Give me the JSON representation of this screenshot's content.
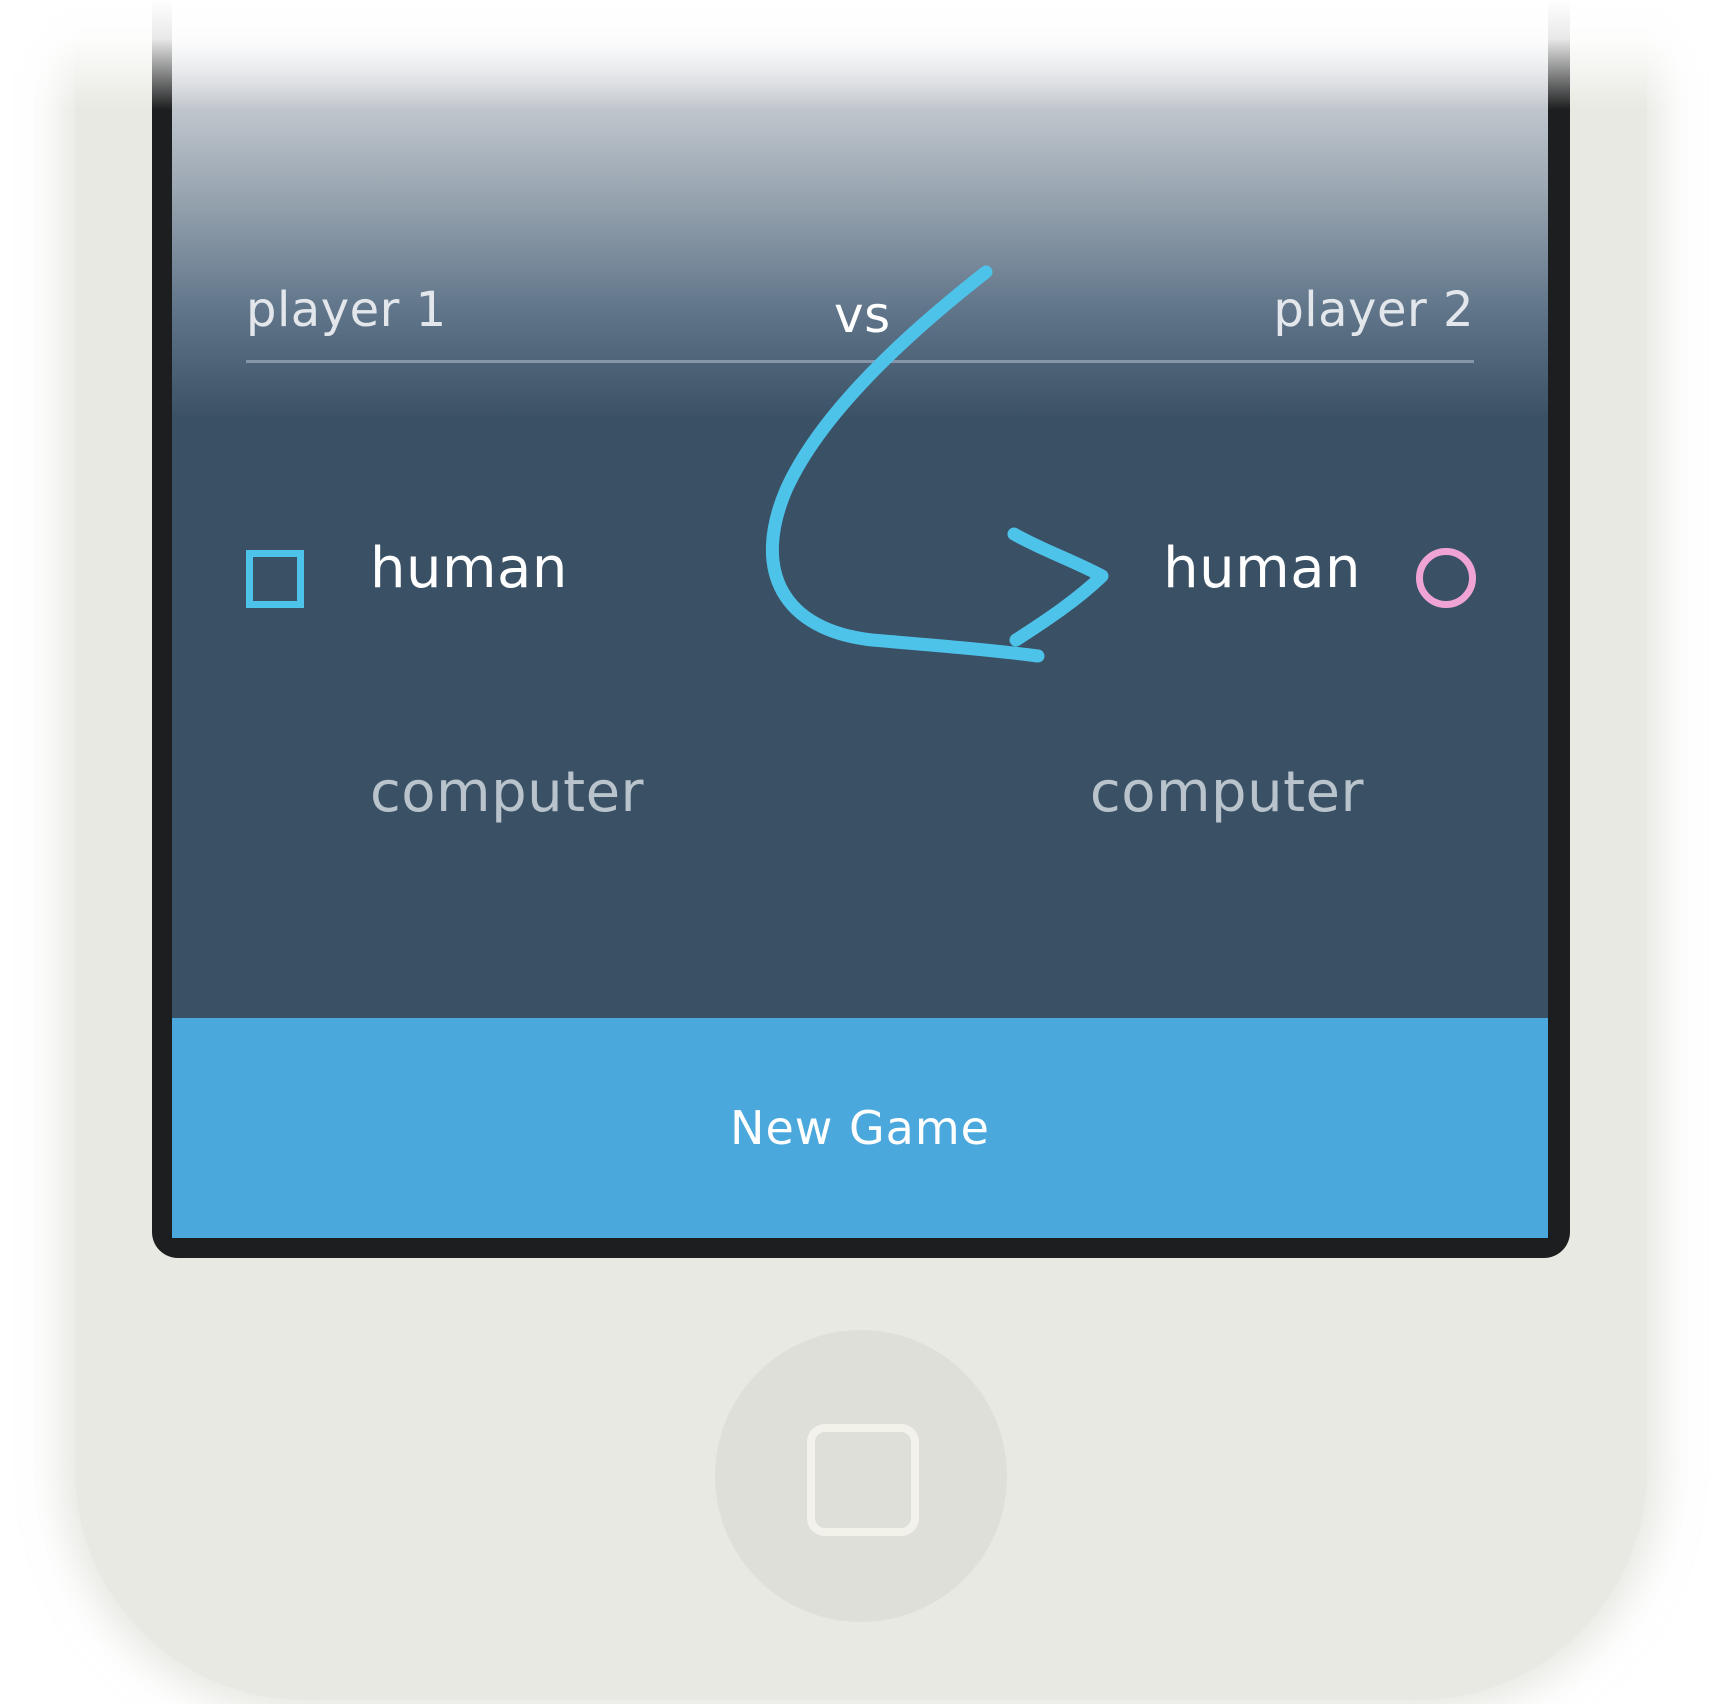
{
  "header": {
    "player1_label": "player 1",
    "vs_label": "vs",
    "player2_label": "player 2"
  },
  "player1": {
    "options": [
      {
        "label": "human",
        "selected": true
      },
      {
        "label": "computer",
        "selected": false
      }
    ],
    "marker_icon": "square-icon",
    "marker_color": "#4ec3ea"
  },
  "player2": {
    "options": [
      {
        "label": "human",
        "selected": true
      },
      {
        "label": "computer",
        "selected": false
      }
    ],
    "marker_icon": "circle-icon",
    "marker_color": "#f0a4d6"
  },
  "annotation": {
    "icon": "curved-arrow-icon",
    "color": "#4ec3ea"
  },
  "action": {
    "new_game_label": "New Game",
    "color": "#4aa8dd"
  },
  "device": {
    "home_button_icon": "home-button-icon"
  }
}
